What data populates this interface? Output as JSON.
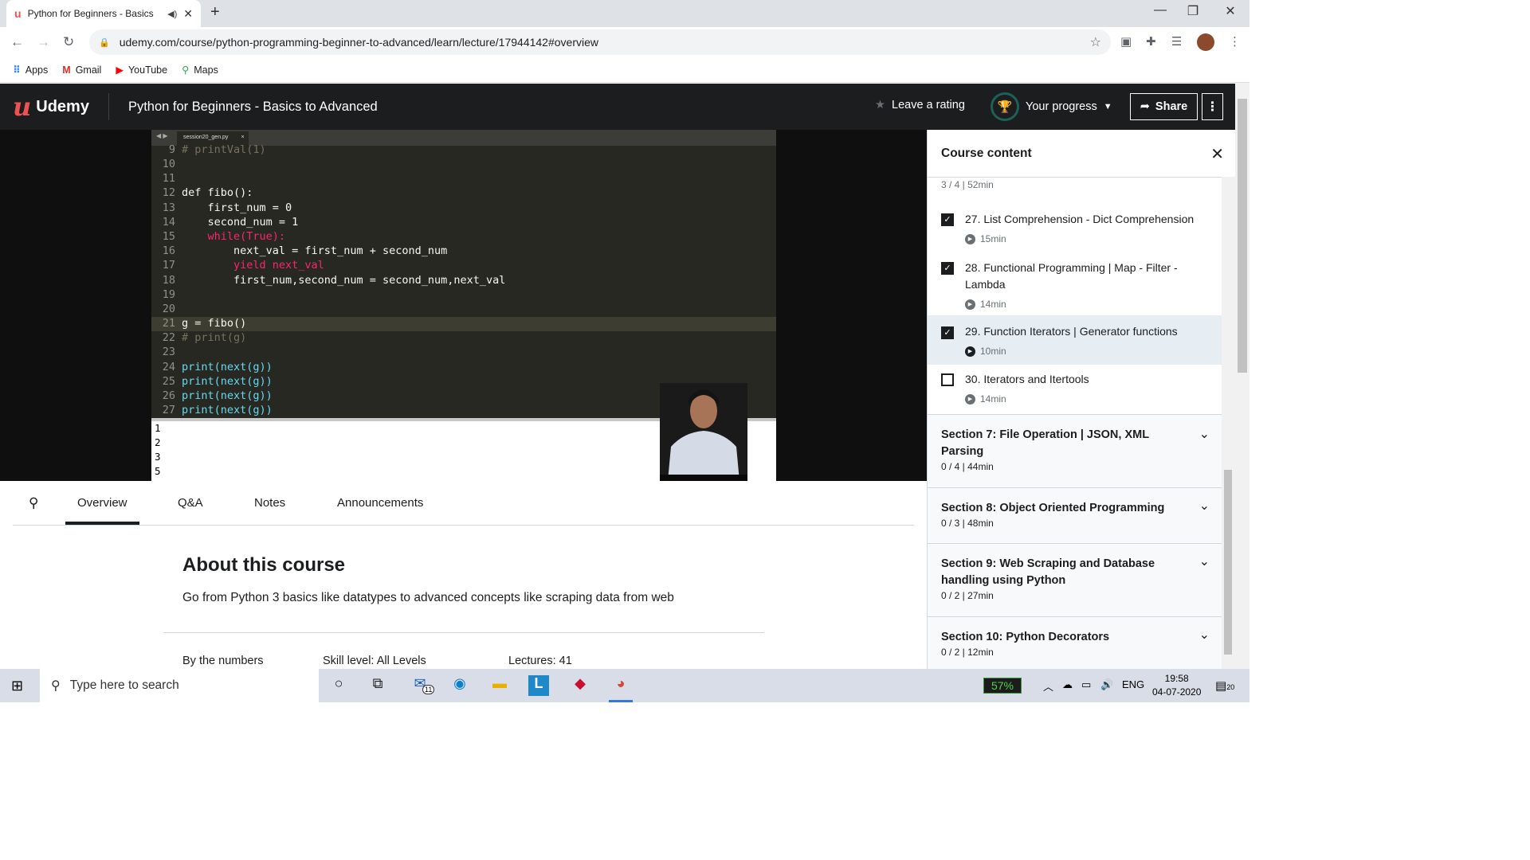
{
  "browser": {
    "tab_title": "Python for Beginners - Basics",
    "address": "udemy.com/course/python-programming-beginner-to-advanced/learn/lecture/17944142#overview",
    "bookmarks": [
      "Apps",
      "Gmail",
      "YouTube",
      "Maps"
    ]
  },
  "header": {
    "logo": "Udemy",
    "course_title": "Python for Beginners - Basics to Advanced",
    "leave_rating": "Leave a rating",
    "progress": "Your progress",
    "share": "Share"
  },
  "video": {
    "editor_tab": "session20_gen.py",
    "code_lines": [
      {
        "n": "9",
        "t": "# printVal(1)"
      },
      {
        "n": "10",
        "t": ""
      },
      {
        "n": "11",
        "t": ""
      },
      {
        "n": "12",
        "t": "def fibo():"
      },
      {
        "n": "13",
        "t": "    first_num = 0"
      },
      {
        "n": "14",
        "t": "    second_num = 1"
      },
      {
        "n": "15",
        "t": "    while(True):"
      },
      {
        "n": "16",
        "t": "        next_val = first_num + second_num"
      },
      {
        "n": "17",
        "t": "        yield next_val"
      },
      {
        "n": "18",
        "t": "        first_num,second_num = second_num,next_val"
      },
      {
        "n": "19",
        "t": ""
      },
      {
        "n": "20",
        "t": ""
      },
      {
        "n": "21",
        "t": "g = fibo()"
      },
      {
        "n": "22",
        "t": "# print(g)"
      },
      {
        "n": "23",
        "t": ""
      },
      {
        "n": "24",
        "t": "print(next(g))"
      },
      {
        "n": "25",
        "t": "print(next(g))"
      },
      {
        "n": "26",
        "t": "print(next(g))"
      },
      {
        "n": "27",
        "t": "print(next(g))"
      }
    ],
    "output_lines": [
      "1",
      "2",
      "3",
      "5"
    ]
  },
  "sidebar": {
    "title": "Course content",
    "section_meta": "3 / 4 | 52min",
    "lectures": [
      {
        "title": "27. List Comprehension - Dict Comprehension",
        "duration": "15min",
        "checked": true
      },
      {
        "title": "28. Functional Programming | Map - Filter - Lambda",
        "duration": "14min",
        "checked": true
      },
      {
        "title": "29. Function Iterators | Generator functions",
        "duration": "10min",
        "checked": true
      },
      {
        "title": "30. Iterators and Itertools",
        "duration": "14min",
        "checked": false
      }
    ],
    "sections": [
      {
        "title": "Section 7: File Operation | JSON, XML Parsing",
        "meta": "0 / 4 | 44min"
      },
      {
        "title": "Section 8: Object Oriented Programming",
        "meta": "0 / 3 | 48min"
      },
      {
        "title": "Section 9: Web Scraping and Database handling using Python",
        "meta": "0 / 2 | 27min"
      },
      {
        "title": "Section 10: Python Decorators",
        "meta": "0 / 2 | 12min"
      }
    ]
  },
  "tabs": [
    "Overview",
    "Q&A",
    "Notes",
    "Announcements"
  ],
  "about": {
    "title": "About this course",
    "description": "Go from Python 3 basics like datatypes to advanced concepts like scraping data from web",
    "by_numbers": "By the numbers",
    "skill_level": "Skill level: All Levels",
    "lectures": "Lectures: 41"
  },
  "taskbar": {
    "search_placeholder": "Type here to search",
    "mail_badge": "11",
    "battery": "57%",
    "lang": "ENG",
    "time": "19:58",
    "date": "04-07-2020",
    "notif_count": "20"
  }
}
